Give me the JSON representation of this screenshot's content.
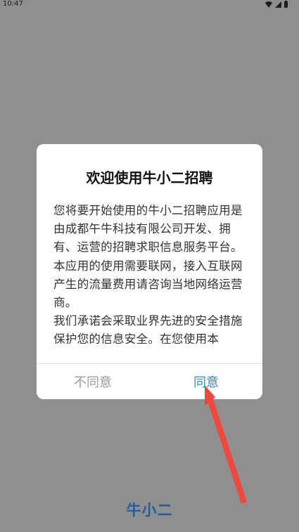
{
  "status_bar": {
    "time": "10:47"
  },
  "dialog": {
    "title": "欢迎使用牛小二招聘",
    "body": [
      "您将要开始使用的牛小二招聘应用是由成都午牛科技有限公司开发、拥有、运营的招聘求职信息服务平台。本应用的使用需要联网，接入互联网产生的流量费用请咨询当地网络运营商。",
      "我们承诺会采取业界先进的安全措施保护您的信息安全。在您使用本"
    ],
    "disagree_label": "不同意",
    "agree_label": "同意"
  },
  "brand": {
    "logo_text": "牛小二"
  },
  "colors": {
    "agree": "#3a8ac9",
    "disagree": "#9b9b9b",
    "overlay": "#8f8f8f",
    "brand": "#1f5e9e",
    "annotation_arrow": "#f0483e"
  }
}
